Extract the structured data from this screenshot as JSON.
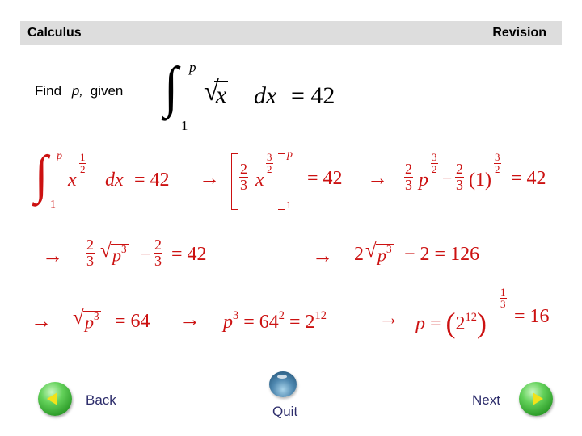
{
  "header": {
    "subject": "Calculus",
    "section": "Revision"
  },
  "question": {
    "prefix": "Find",
    "variable": "p,",
    "suffix": "given",
    "integral": {
      "upper_limit": "p",
      "lower_limit": "1",
      "integrand_radicand": "x",
      "differential": "dx",
      "equals": "= 42"
    }
  },
  "steps": {
    "row1": {
      "integral_upper": "p",
      "integral_lower": "1",
      "base": "x",
      "exp_num": "1",
      "exp_den": "2",
      "differential": "dx",
      "equals": "= 42",
      "arrow1": "→",
      "coef_num": "2",
      "coef_den": "3",
      "anti_base": "x",
      "anti_exp_num": "3",
      "anti_exp_den": "2",
      "eval_upper": "p",
      "eval_lower": "1",
      "equals2": "= 42",
      "arrow2": "→",
      "t1_num": "2",
      "t1_den": "3",
      "t1_base": "p",
      "t1_exp_num": "3",
      "t1_exp_den": "2",
      "minus": "−",
      "t2_num": "2",
      "t2_den": "3",
      "t2_base": "(1)",
      "t2_exp_num": "3",
      "t2_exp_den": "2",
      "equals3": "= 42"
    },
    "row2": {
      "arrow1": "→",
      "c_num": "2",
      "c_den": "3",
      "rad_base": "p",
      "rad_exp": "3",
      "minus": "−",
      "d_num": "2",
      "d_den": "3",
      "equals": "= 42",
      "arrow2": "→",
      "coef": "2",
      "rad2_base": "p",
      "rad2_exp": "3",
      "rest": "− 2 = 126"
    },
    "row3": {
      "arrow1": "→",
      "rad_base": "p",
      "rad_exp": "3",
      "equals1": "= 64",
      "arrow2": "→",
      "lhs_base": "p",
      "lhs_exp": "3",
      "mid": "= 64",
      "mid_exp": "2",
      "mid2": "= 2",
      "mid2_exp": "12",
      "arrow3": "→",
      "p": "p",
      "eq": "=",
      "inner_base": "2",
      "inner_exp": "12",
      "outer_exp_num": "1",
      "outer_exp_den": "3",
      "result": "= 16"
    }
  },
  "nav": {
    "back_label": "Back",
    "quit_label": "Quit",
    "next_label": "Next"
  }
}
